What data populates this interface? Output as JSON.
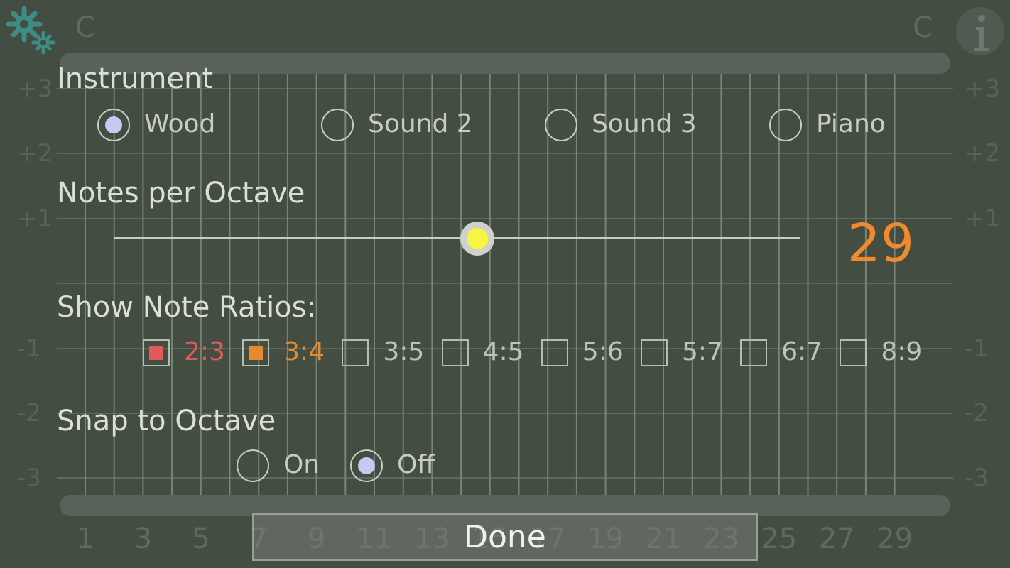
{
  "header": {
    "left_note": "C",
    "right_note": "C"
  },
  "icons": {
    "settings": "gears-icon",
    "info": "info-icon"
  },
  "side_scale": [
    "+3",
    "+2",
    "+1",
    "-1",
    "-2",
    "-3"
  ],
  "bottom_scale": [
    "1",
    "3",
    "5",
    "7",
    "9",
    "11",
    "13",
    "15",
    "17",
    "19",
    "21",
    "23",
    "25",
    "27",
    "29"
  ],
  "instrument": {
    "title": "Instrument",
    "options": [
      {
        "label": "Wood",
        "checked": true
      },
      {
        "label": "Sound 2",
        "checked": false
      },
      {
        "label": "Sound 3",
        "checked": false
      },
      {
        "label": "Piano",
        "checked": false
      }
    ]
  },
  "notes_per_octave": {
    "title": "Notes per Octave",
    "value": "29",
    "slider_fraction": 0.53
  },
  "ratios": {
    "title": "Show Note Ratios:",
    "items": [
      {
        "label": "2:3",
        "checked": true,
        "color": "#e05a5a"
      },
      {
        "label": "3:4",
        "checked": true,
        "color": "#e58a2e"
      },
      {
        "label": "3:5",
        "checked": false,
        "color": "#bfc2bb"
      },
      {
        "label": "4:5",
        "checked": false,
        "color": "#bfc2bb"
      },
      {
        "label": "5:6",
        "checked": false,
        "color": "#bfc2bb"
      },
      {
        "label": "5:7",
        "checked": false,
        "color": "#bfc2bb"
      },
      {
        "label": "6:7",
        "checked": false,
        "color": "#bfc2bb"
      },
      {
        "label": "8:9",
        "checked": false,
        "color": "#bfc2bb"
      }
    ]
  },
  "snap": {
    "title": "Snap to Octave",
    "options": [
      {
        "label": "On",
        "checked": false
      },
      {
        "label": "Off",
        "checked": true
      }
    ]
  },
  "done_label": "Done",
  "colors": {
    "value_orange": "#f08a2a",
    "slider_knob": "#f5f542",
    "radio_dot": "#c8c8f0"
  }
}
